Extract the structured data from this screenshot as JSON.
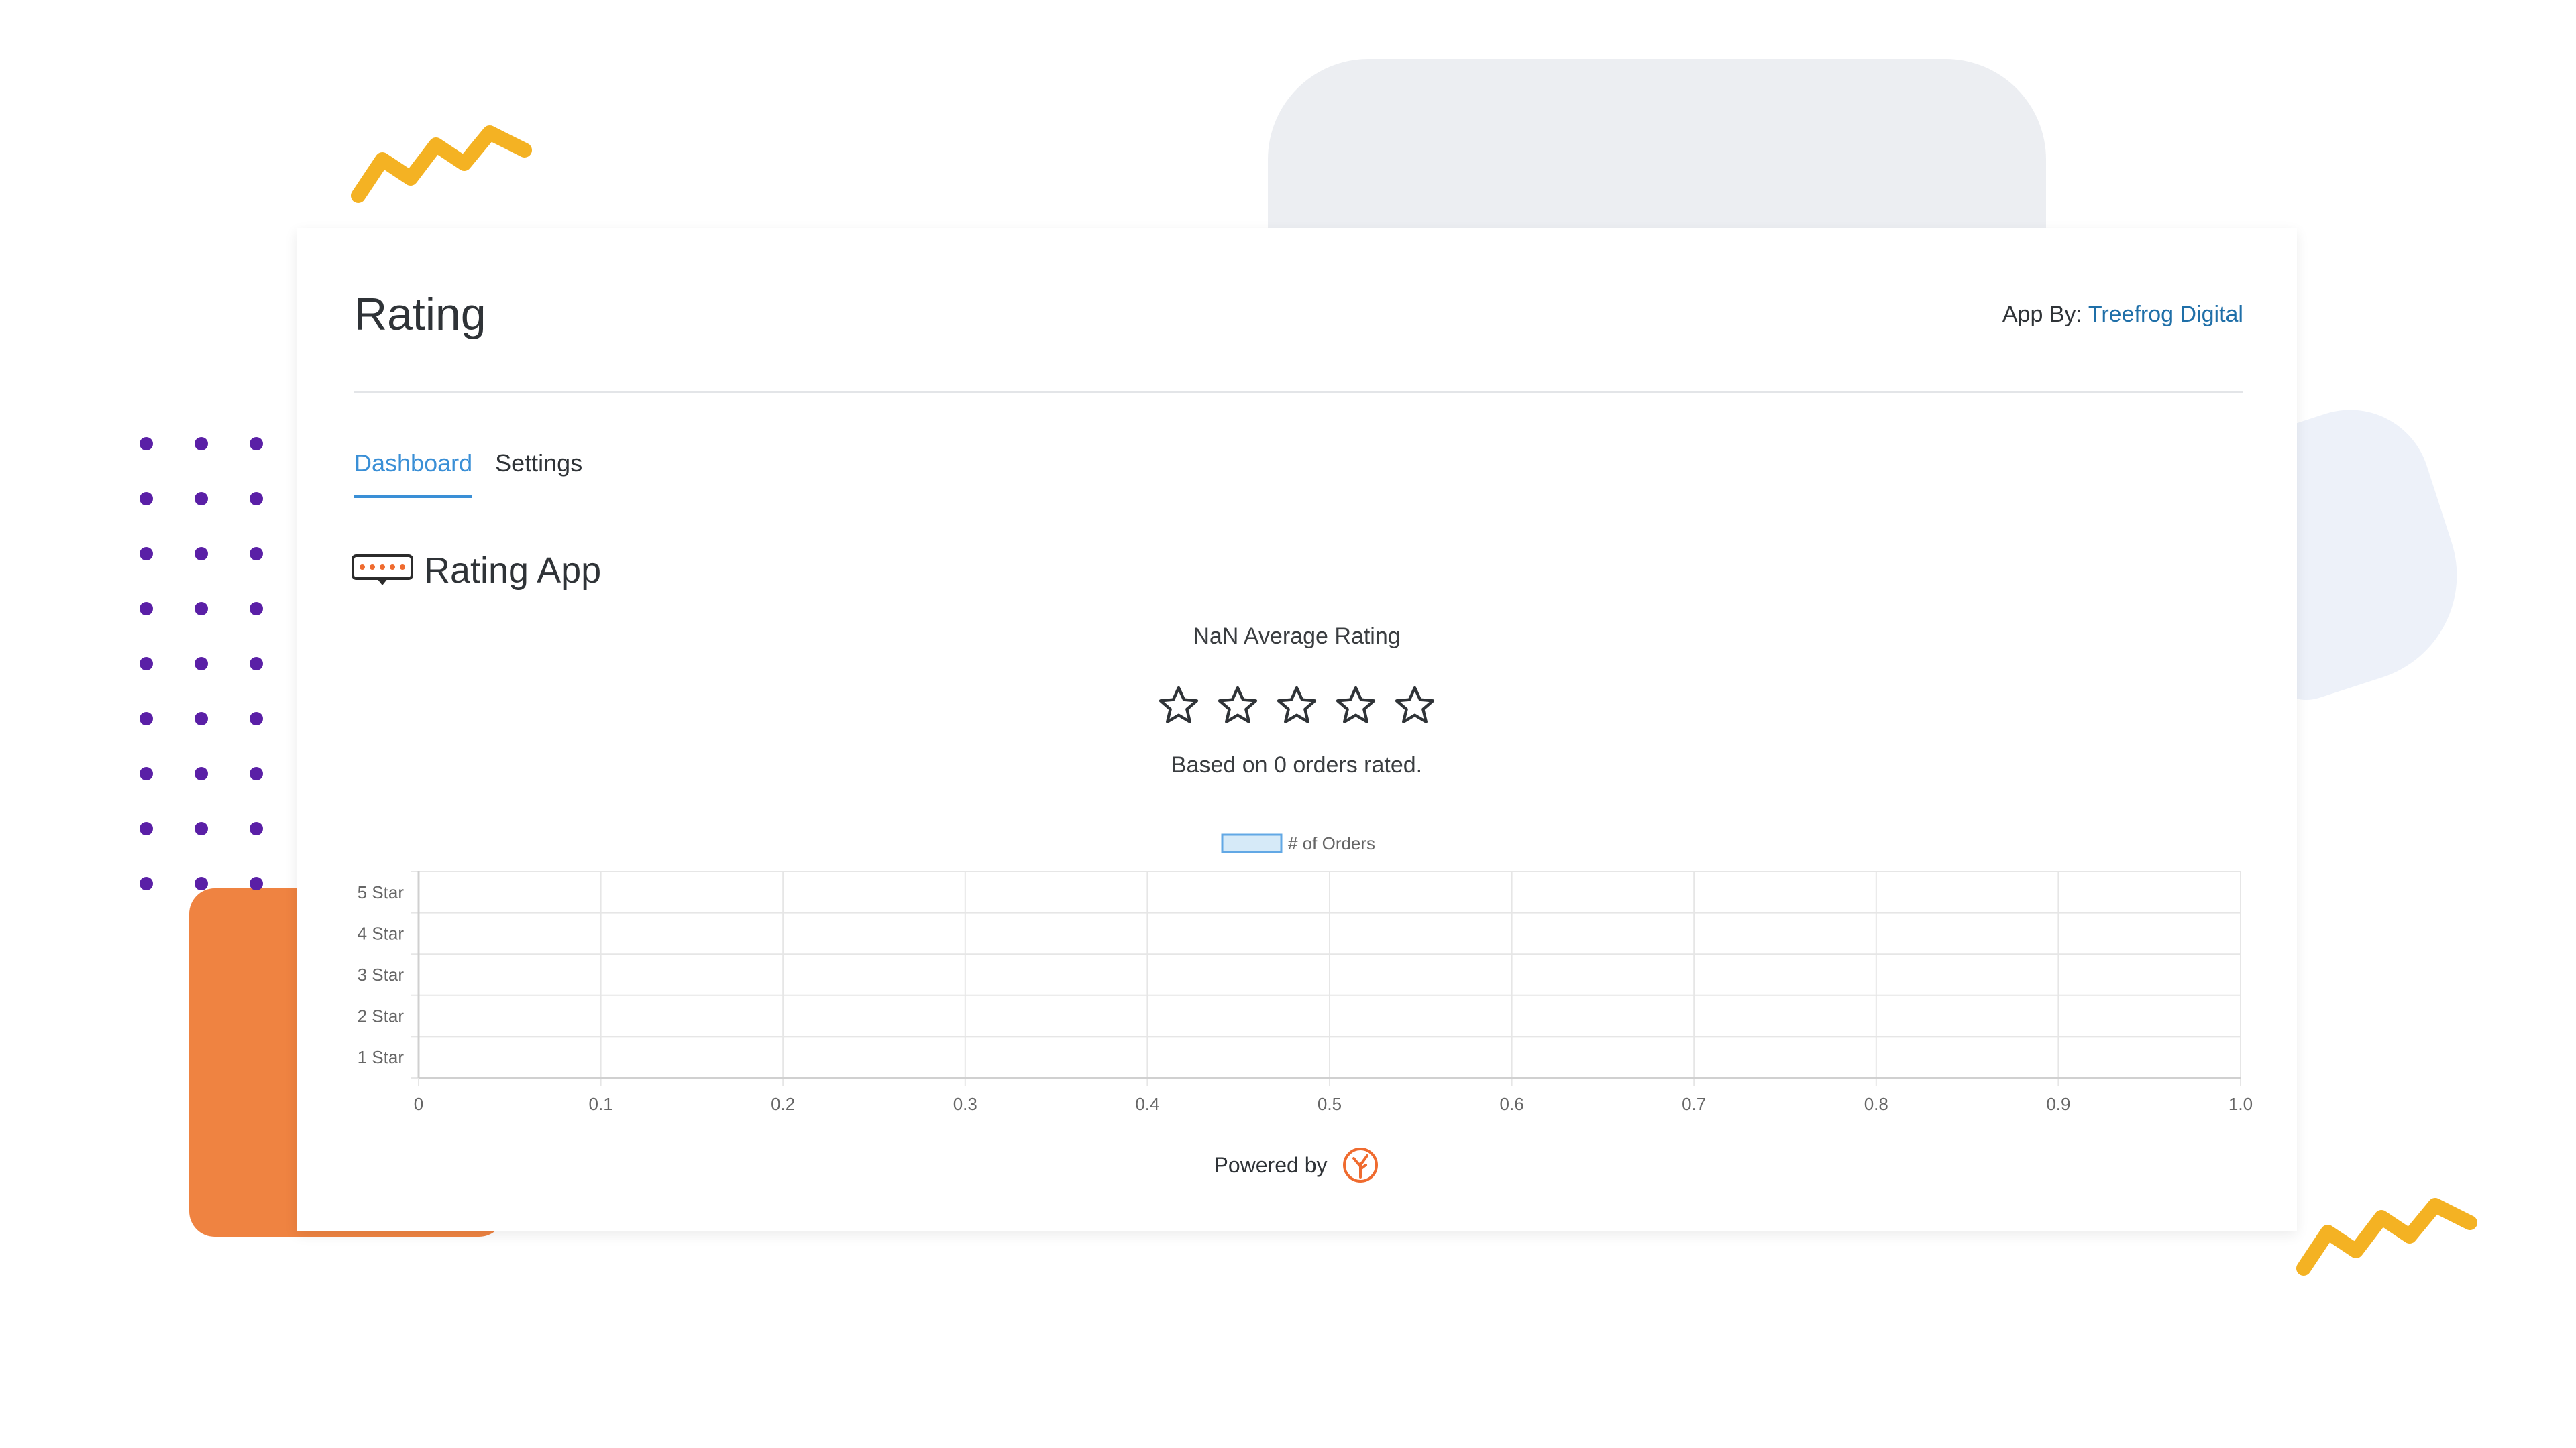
{
  "header": {
    "title": "Rating",
    "app_by_label": "App By:",
    "app_by_link": "Treefrog Digital"
  },
  "tabs": [
    {
      "label": "Dashboard",
      "active": true
    },
    {
      "label": "Settings",
      "active": false
    }
  ],
  "app": {
    "name": "Rating App",
    "icon": "rating-badge-icon"
  },
  "summary": {
    "average_text": "NaN Average Rating",
    "stars_filled": 0,
    "stars_total": 5,
    "based_on_text": "Based on 0 orders rated."
  },
  "chart_data": {
    "type": "bar",
    "orientation": "horizontal",
    "categories": [
      "5 Star",
      "4 Star",
      "3 Star",
      "2 Star",
      "1 Star"
    ],
    "series": [
      {
        "name": "# of Orders",
        "values": [
          0,
          0,
          0,
          0,
          0
        ]
      }
    ],
    "x_ticks": [
      "0",
      "0.1",
      "0.2",
      "0.3",
      "0.4",
      "0.5",
      "0.6",
      "0.7",
      "0.8",
      "0.9",
      "1.0"
    ],
    "xlim": [
      0,
      1
    ],
    "grid": true,
    "legend_position": "top",
    "series_color": "#d6eaf8",
    "series_border": "#62a8e5"
  },
  "footer": {
    "powered_by": "Powered by",
    "logo_icon": "treefrog-logo-icon"
  },
  "colors": {
    "accent": "#3a8fd6",
    "link": "#1f6fa8",
    "decor_orange": "#ef8341",
    "decor_yellow": "#f4b223",
    "decor_purple": "#5a1fa6"
  }
}
